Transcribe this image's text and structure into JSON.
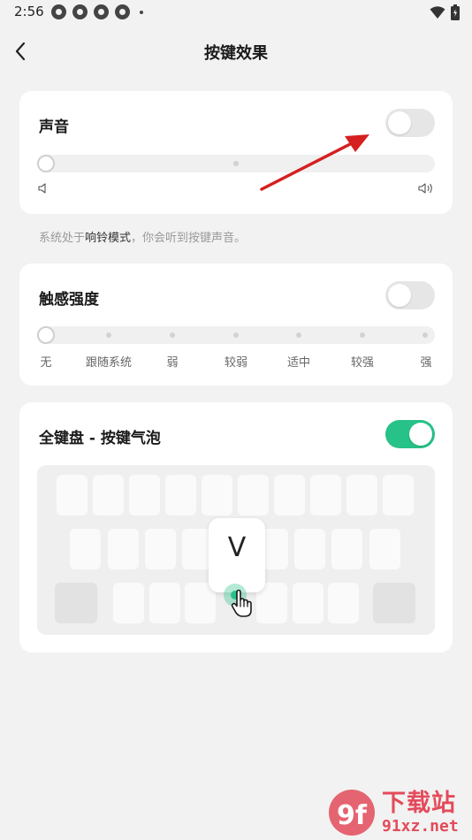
{
  "status_bar": {
    "time": "2:56"
  },
  "header": {
    "title": "按键效果"
  },
  "sound": {
    "label": "声音",
    "enabled": false,
    "level": 0,
    "hint_prefix": "系统处于",
    "hint_mode": "响铃模式",
    "hint_suffix": "，你会听到按键声音。"
  },
  "haptic": {
    "label": "触感强度",
    "enabled": false,
    "levels": [
      "无",
      "跟随系统",
      "弱",
      "较弱",
      "适中",
      "较强",
      "强"
    ],
    "selected_index": 0
  },
  "popup": {
    "label": "全键盘 - 按键气泡",
    "enabled": true,
    "preview_key": "V"
  },
  "watermark": {
    "name": "下载站",
    "url": "91xz.net",
    "logo": "9f"
  },
  "colors": {
    "accent": "#27c288",
    "annotation_arrow": "#d61f1f"
  }
}
